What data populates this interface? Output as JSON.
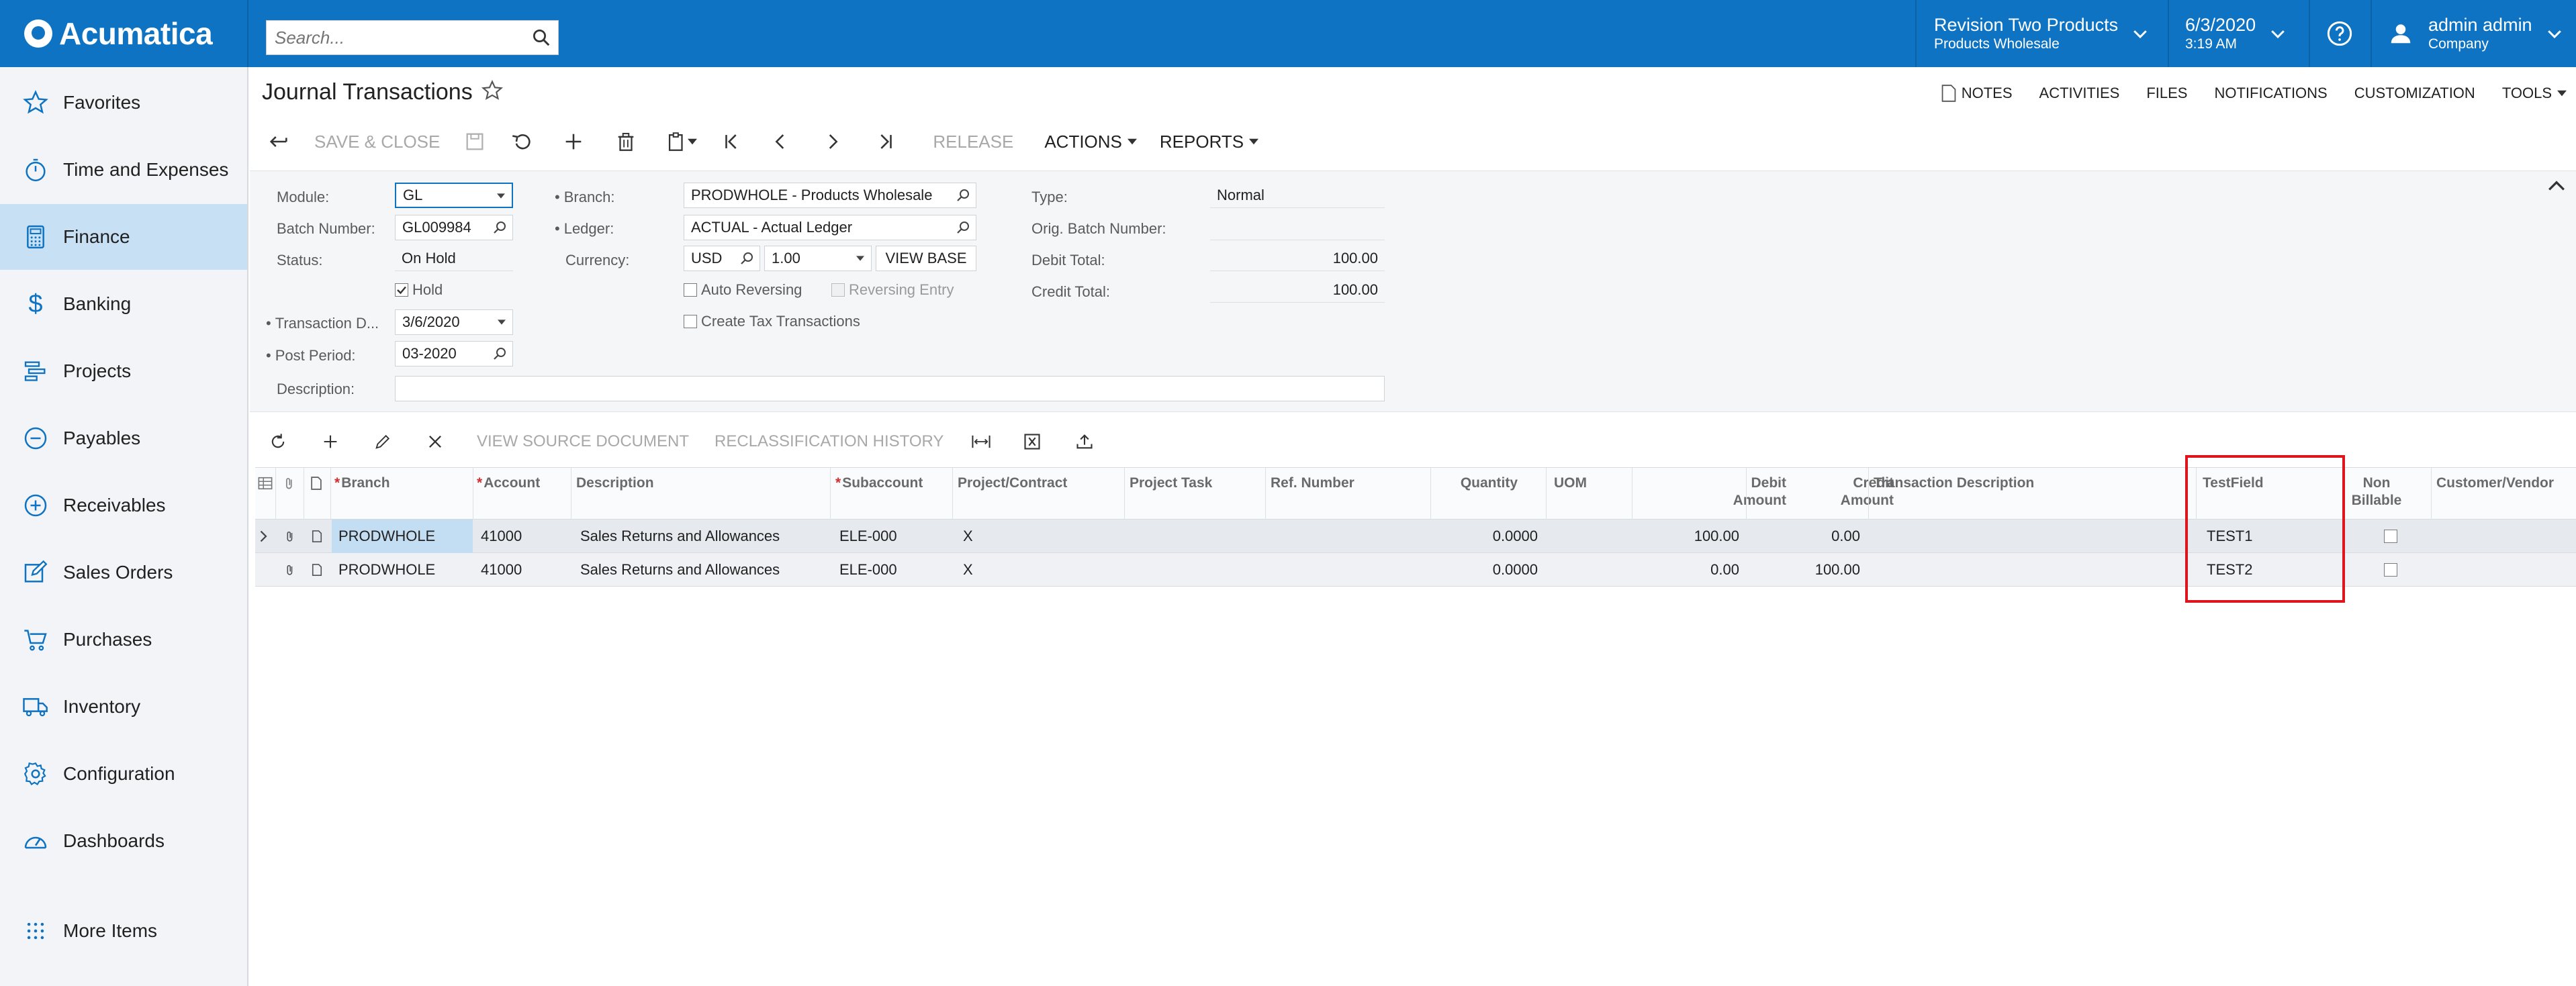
{
  "app": {
    "logo": "Acumatica",
    "search_placeholder": "Search...",
    "company": {
      "name": "Revision Two Products",
      "sub": "Products Wholesale"
    },
    "date": {
      "date": "6/3/2020",
      "time": "3:19 AM"
    },
    "user": {
      "name": "admin admin",
      "sub": "Company"
    }
  },
  "sidebar": {
    "items": [
      {
        "label": "Favorites",
        "icon": "star-icon"
      },
      {
        "label": "Time and Expenses",
        "icon": "stopwatch-icon"
      },
      {
        "label": "Finance",
        "icon": "calculator-icon"
      },
      {
        "label": "Banking",
        "icon": "dollar-icon"
      },
      {
        "label": "Projects",
        "icon": "projects-icon"
      },
      {
        "label": "Payables",
        "icon": "minus-circle-icon"
      },
      {
        "label": "Receivables",
        "icon": "plus-circle-icon"
      },
      {
        "label": "Sales Orders",
        "icon": "pencil-square-icon"
      },
      {
        "label": "Purchases",
        "icon": "cart-icon"
      },
      {
        "label": "Inventory",
        "icon": "truck-icon"
      },
      {
        "label": "Configuration",
        "icon": "gear-icon"
      },
      {
        "label": "Dashboards",
        "icon": "gauge-icon"
      },
      {
        "label": "More Items",
        "icon": "grid-dots-icon"
      }
    ]
  },
  "screen": {
    "title": "Journal Transactions",
    "header_links": [
      "NOTES",
      "ACTIVITIES",
      "FILES",
      "NOTIFICATIONS",
      "CUSTOMIZATION",
      "TOOLS"
    ],
    "toolbar": {
      "save_close": "SAVE & CLOSE",
      "release": "RELEASE",
      "actions": "ACTIONS",
      "reports": "REPORTS"
    }
  },
  "form": {
    "module_label": "Module:",
    "module": "GL",
    "batch_label": "Batch Number:",
    "batch": "GL009984",
    "status_label": "Status:",
    "status": "On Hold",
    "hold_label": "Hold",
    "tran_date_label": "Transaction D...",
    "tran_date": "3/6/2020",
    "post_period_label": "Post Period:",
    "post_period": "03-2020",
    "description_label": "Description:",
    "description": "",
    "branch_label": "Branch:",
    "branch": "PRODWHOLE - Products Wholesale",
    "ledger_label": "Ledger:",
    "ledger": "ACTUAL - Actual Ledger",
    "currency_label": "Currency:",
    "currency": "USD",
    "rate": "1.00",
    "view_base": "VIEW BASE",
    "auto_reversing": "Auto Reversing",
    "reversing_entry": "Reversing Entry",
    "create_tax": "Create Tax Transactions",
    "type_label": "Type:",
    "type": "Normal",
    "orig_batch_label": "Orig. Batch Number:",
    "orig_batch": "",
    "debit_total_label": "Debit Total:",
    "debit_total": "100.00",
    "credit_total_label": "Credit Total:",
    "credit_total": "100.00"
  },
  "grid": {
    "toolbar": {
      "view_source": "VIEW SOURCE DOCUMENT",
      "reclass_history": "RECLASSIFICATION HISTORY"
    },
    "columns": {
      "branch": "Branch",
      "account": "Account",
      "description": "Description",
      "subaccount": "Subaccount",
      "project": "Project/Contract",
      "task": "Project Task",
      "ref": "Ref. Number",
      "quantity": "Quantity",
      "uom": "UOM",
      "debit_1": "Debit",
      "debit_2": "Amount",
      "credit_1": "Credit",
      "credit_2": "Amount",
      "tran_desc": "Transaction Description",
      "testfield": "TestField",
      "nonbill_1": "Non",
      "nonbill_2": "Billable",
      "customer": "Customer/Vendor"
    },
    "rows": [
      {
        "branch": "PRODWHOLE",
        "account": "41000",
        "description": "Sales Returns and Allowances",
        "subaccount": "ELE-000",
        "project": "X",
        "quantity": "0.0000",
        "debit": "100.00",
        "credit": "0.00",
        "testfield": "TEST1"
      },
      {
        "branch": "PRODWHOLE",
        "account": "41000",
        "description": "Sales Returns and Allowances",
        "subaccount": "ELE-000",
        "project": "X",
        "quantity": "0.0000",
        "debit": "0.00",
        "credit": "100.00",
        "testfield": "TEST2"
      }
    ]
  },
  "colors": {
    "brand": "#0e73c2",
    "active_nav": "#c8e0f4",
    "highlight": "#e0141c"
  }
}
